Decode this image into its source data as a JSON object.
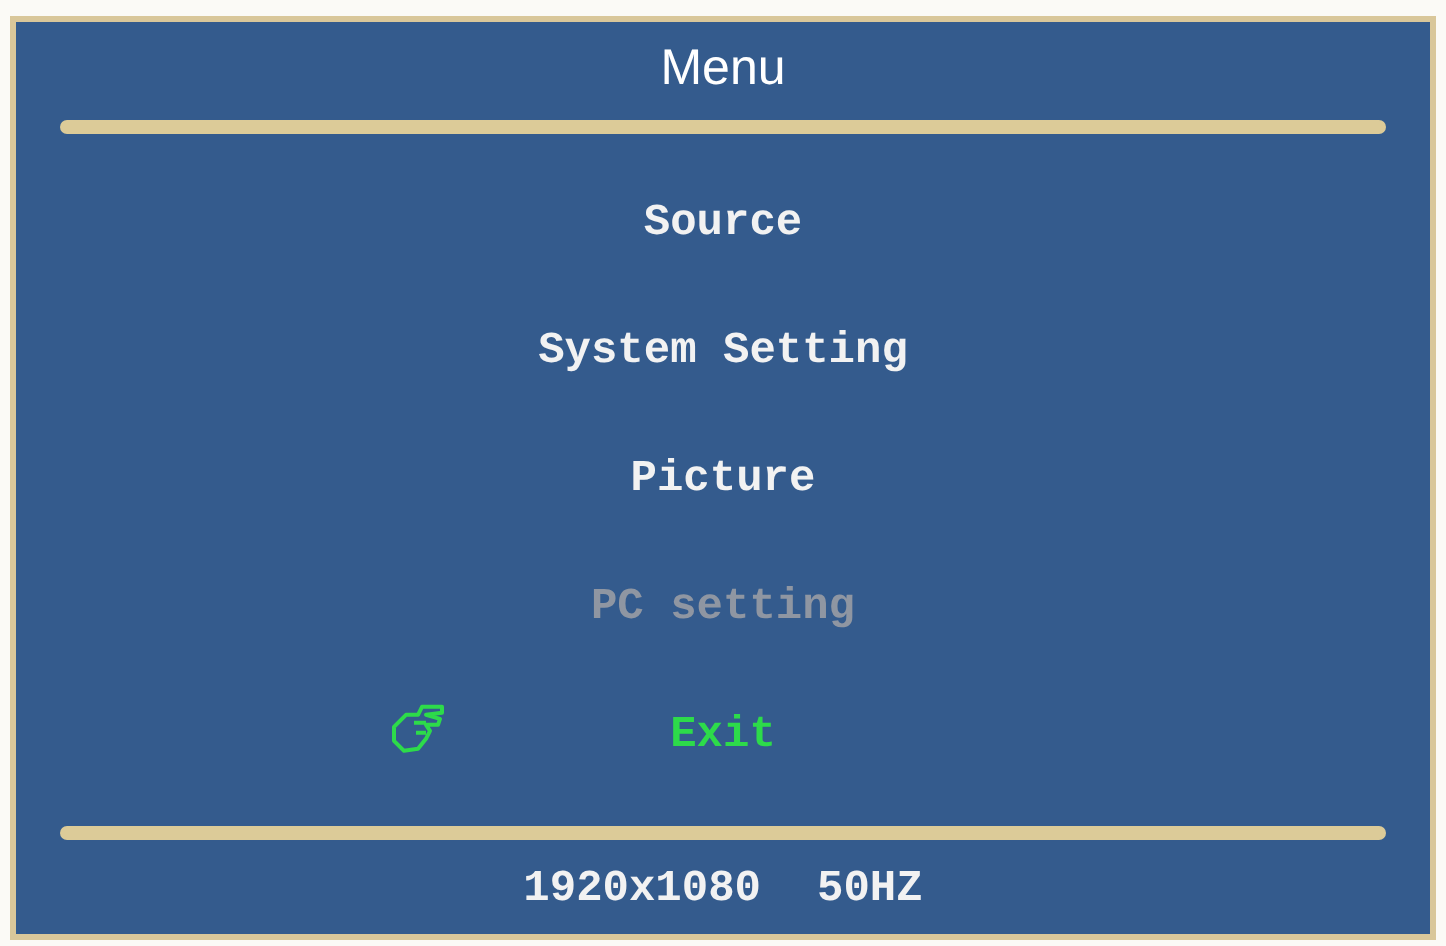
{
  "window": {
    "title": "Menu"
  },
  "items": [
    {
      "label": "Source",
      "selected": false,
      "disabled": false
    },
    {
      "label": "System Setting",
      "selected": false,
      "disabled": false
    },
    {
      "label": "Picture",
      "selected": false,
      "disabled": false
    },
    {
      "label": "PC setting",
      "selected": false,
      "disabled": true
    },
    {
      "label": "Exit",
      "selected": true,
      "disabled": false
    }
  ],
  "status_bar": {
    "resolution": "1920x1080",
    "refresh_rate": "50HZ"
  }
}
